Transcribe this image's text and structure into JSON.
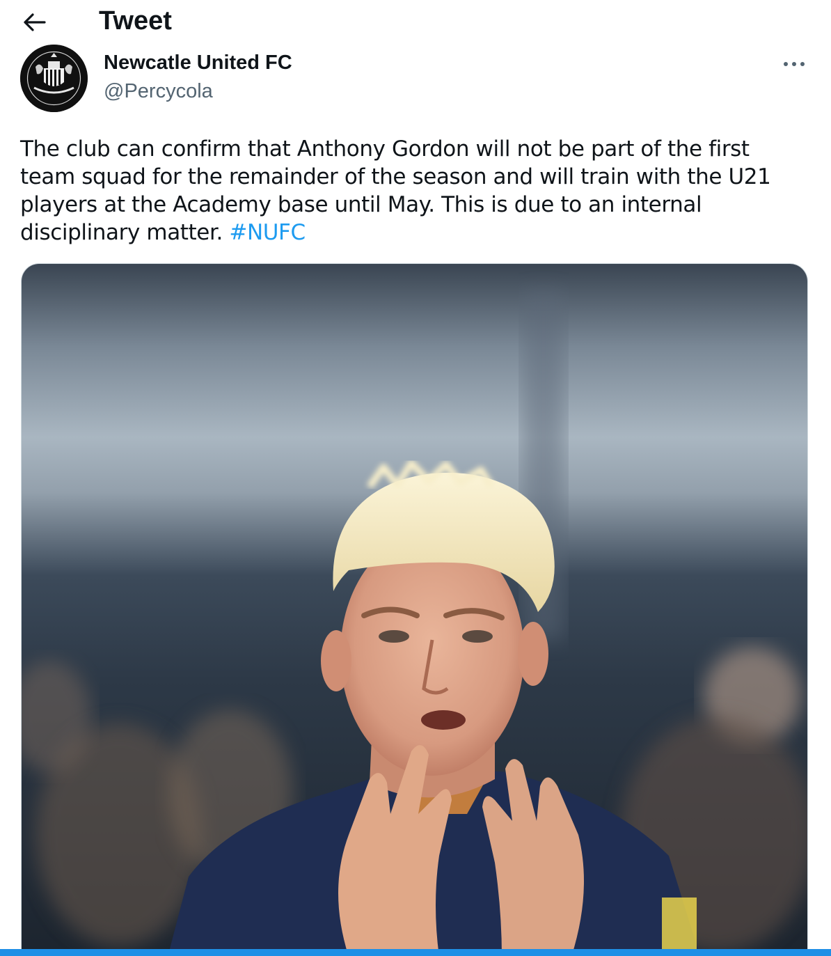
{
  "header": {
    "title": "Tweet",
    "back_icon": "arrow-left-icon"
  },
  "author": {
    "display_name": "Newcatle United FC",
    "handle": "@Percycola",
    "avatar_icon": "club-crest-icon",
    "more_icon": "more-dots-icon"
  },
  "tweet": {
    "lines": [
      "The club can confirm that Anthony Gordon will not be part of the first",
      "team squad for the remainder of the season and will train with the U21",
      "players at the Academy base until May. This is due to an internal",
      "disciplinary matter."
    ],
    "hashtag": "#NUFC"
  },
  "colors": {
    "text": "#0f1419",
    "secondary": "#536471",
    "link": "#1d9bf0",
    "jersey": "#1f2d52",
    "accent_bar": "#1f8fe6"
  }
}
